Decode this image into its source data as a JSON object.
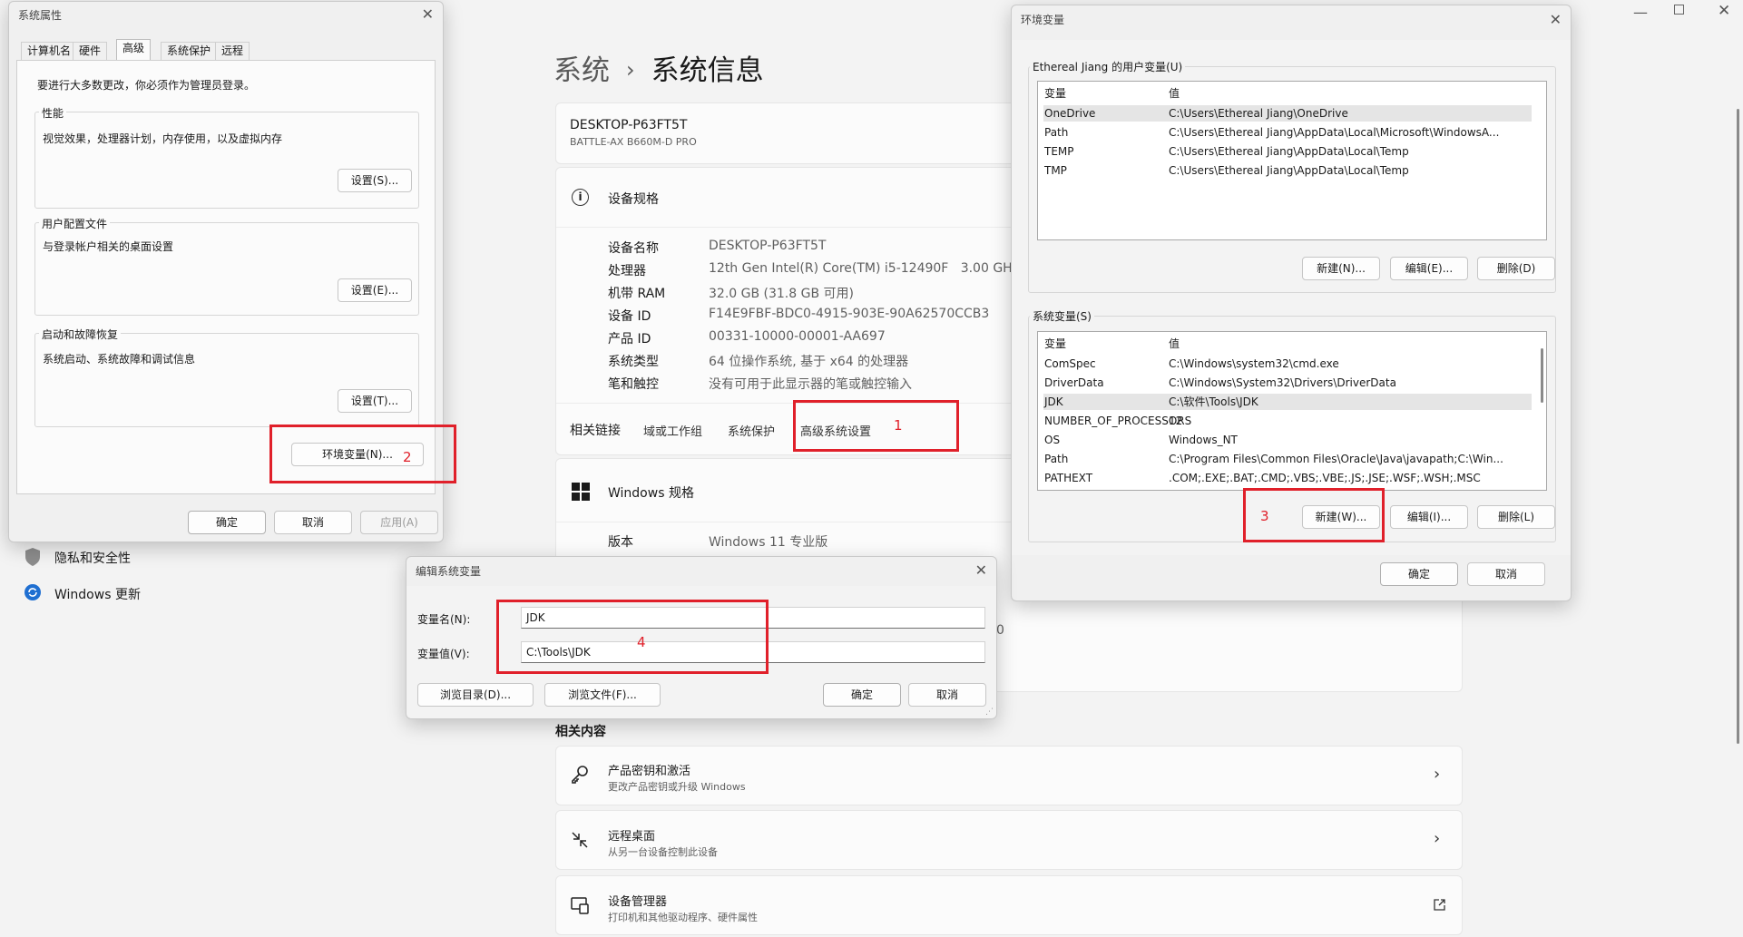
{
  "settings": {
    "breadcrumb_parent": "系统",
    "breadcrumb_sep": "›",
    "breadcrumb_current": "系统信息",
    "device_name": "DESKTOP-P63FT5T",
    "device_board": "BATTLE-AX B660M-D PRO",
    "spec_header": "设备规格",
    "specs": [
      {
        "label": "设备名称",
        "value": "DESKTOP-P63FT5T"
      },
      {
        "label": "处理器",
        "value": "12th Gen Intel(R) Core(TM) i5-12490F   3.00 GHz"
      },
      {
        "label": "机带 RAM",
        "value": "32.0 GB (31.8 GB 可用)"
      },
      {
        "label": "设备 ID",
        "value": "F14E9FBF-BDC0-4915-903E-90A62570CCB3"
      },
      {
        "label": "产品 ID",
        "value": "00331-10000-00001-AA697"
      },
      {
        "label": "系统类型",
        "value": "64 位操作系统, 基于 x64 的处理器"
      },
      {
        "label": "笔和触控",
        "value": "没有可用于此显示器的笔或触控输入"
      }
    ],
    "related_links_label": "相关链接",
    "related_links": [
      "域或工作组",
      "系统保护",
      "高级系统设置"
    ],
    "windows_spec_header": "Windows 规格",
    "version_label": "版本",
    "version_value": "Windows 11 专业版",
    "partial_text": "0",
    "related_content_header": "相关内容",
    "related_content": [
      {
        "title": "产品密钥和激活",
        "subtitle": "更改产品密钥或升级 Windows"
      },
      {
        "title": "远程桌面",
        "subtitle": "从另一台设备控制此设备"
      },
      {
        "title": "设备管理器",
        "subtitle": "打印机和其他驱动程序、硬件属性"
      }
    ],
    "nav": [
      {
        "label": "隐私和安全性"
      },
      {
        "label": "Windows 更新"
      }
    ]
  },
  "sysprops": {
    "title": "系统属性",
    "tabs": [
      "计算机名",
      "硬件",
      "高级",
      "系统保护",
      "远程"
    ],
    "active_tab": "高级",
    "admin_note": "要进行大多数更改，你必须作为管理员登录。",
    "perf_label": "性能",
    "perf_desc": "视觉效果，处理器计划，内存使用，以及虚拟内存",
    "perf_btn": "设置(S)...",
    "profile_label": "用户配置文件",
    "profile_desc": "与登录帐户相关的桌面设置",
    "profile_btn": "设置(E)...",
    "startup_label": "启动和故障恢复",
    "startup_desc": "系统启动、系统故障和调试信息",
    "startup_btn": "设置(T)...",
    "env_btn": "环境变量(N)...",
    "ok": "确定",
    "cancel": "取消",
    "apply": "应用(A)"
  },
  "envvars": {
    "title": "环境变量",
    "user_group": "Ethereal Jiang 的用户变量(U)",
    "col_var": "变量",
    "col_val": "值",
    "user_vars": [
      {
        "name": "OneDrive",
        "value": "C:\\Users\\Ethereal Jiang\\OneDrive"
      },
      {
        "name": "Path",
        "value": "C:\\Users\\Ethereal Jiang\\AppData\\Local\\Microsoft\\WindowsA..."
      },
      {
        "name": "TEMP",
        "value": "C:\\Users\\Ethereal Jiang\\AppData\\Local\\Temp"
      },
      {
        "name": "TMP",
        "value": "C:\\Users\\Ethereal Jiang\\AppData\\Local\\Temp"
      }
    ],
    "user_new": "新建(N)...",
    "user_edit": "编辑(E)...",
    "user_delete": "删除(D)",
    "sys_group": "系统变量(S)",
    "sys_vars": [
      {
        "name": "ComSpec",
        "value": "C:\\Windows\\system32\\cmd.exe"
      },
      {
        "name": "DriverData",
        "value": "C:\\Windows\\System32\\Drivers\\DriverData"
      },
      {
        "name": "JDK",
        "value": "C:\\软件\\Tools\\JDK"
      },
      {
        "name": "NUMBER_OF_PROCESSORS",
        "value": "12"
      },
      {
        "name": "OS",
        "value": "Windows_NT"
      },
      {
        "name": "Path",
        "value": "C:\\Program Files\\Common Files\\Oracle\\Java\\javapath;C:\\Win..."
      },
      {
        "name": "PATHEXT",
        "value": ".COM;.EXE;.BAT;.CMD;.VBS;.VBE;.JS;.JSE;.WSF;.WSH;.MSC"
      }
    ],
    "sys_new": "新建(W)...",
    "sys_edit": "编辑(I)...",
    "sys_delete": "删除(L)",
    "ok": "确定",
    "cancel": "取消"
  },
  "editvar": {
    "title": "编辑系统变量",
    "name_label": "变量名(N):",
    "name_value": "JDK",
    "value_label": "变量值(V):",
    "value_value": "C:\\Tools\\JDK",
    "browse_dir": "浏览目录(D)...",
    "browse_file": "浏览文件(F)...",
    "ok": "确定",
    "cancel": "取消"
  },
  "annotations": [
    "1",
    "2",
    "3",
    "4"
  ],
  "colors": {
    "annotation_red": "#e0202a",
    "window_bg": "#f3f3f3",
    "dialog_bg": "#f0f0f0"
  }
}
